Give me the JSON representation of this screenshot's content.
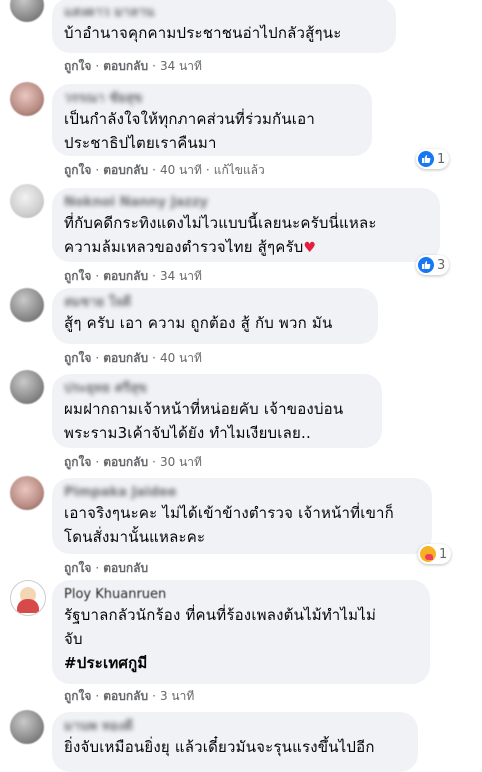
{
  "labels": {
    "like": "ถูกใจ",
    "reply": "ตอบกลับ",
    "edited": "แก้ไขแล้ว",
    "separator": "·"
  },
  "comments": [
    {
      "name": "แสงดาว มาลาน",
      "text": "บ้าอำนาจคุกคามประชาชนอ่าไปกลัวสู้ๆนะ",
      "time": "34 นาที"
    },
    {
      "name": "วรรณา ชัยสุข",
      "text": "เป็นกำลังใจให้ทุกภาคส่วนที่ร่วมกันเอา\nประชาธิปไตยเราคืนมา",
      "time": "40 นาที",
      "edited": true,
      "reactions": "1"
    },
    {
      "name": "Noknoi Nanny Jazzy",
      "text": "ที่กับคดีกระทิงแดงไม่ไวแบบนี้เลยนะครับนี่แหละ\nความล้มเหลวของตำรวจไทย สู้ๆครับ",
      "emoji": "heart",
      "time": "34 นาที",
      "reactions": "3"
    },
    {
      "name": "สมชาย ใจดี",
      "text": "สู้ๆ ครับ เอา ความ ถูกต้อง สู้ กับ พวก มัน",
      "time": "40 นาที"
    },
    {
      "name": "ประยุทธ ศรีสุข",
      "text": "ผมฝากถามเจ้าหน้าที่หน่อยคับ เจ้าของบ่อน\nพระราม3เค้าจับได้ยัง ทำไมเงียบเลย..",
      "time": "30 นาที"
    },
    {
      "name": "Pimpaka Jaidee",
      "text": "เอาจริงๆนะคะ ไม่ได้เข้าข้างตำรวจ เจ้าหน้าที่เขาก็\nโดนสั่งมานั้นแหละคะ",
      "time": "",
      "reactions": "1"
    },
    {
      "name": "Ploy Khuanruen",
      "text": "รัฐบาลกลัวนักร้อง ที่คนที่ร้องเพลงต้นไม้ทำไมไม่\nจับ",
      "hashtag": "#ประเทศกูมี",
      "time": "3 นาที"
    },
    {
      "name": "มานพ ทองดี",
      "text": "ยิ่งจับเหมือนยิ่งยุ แล้วเดี๋ยวมันจะรุนแรงขึ้นไปอีก"
    }
  ]
}
